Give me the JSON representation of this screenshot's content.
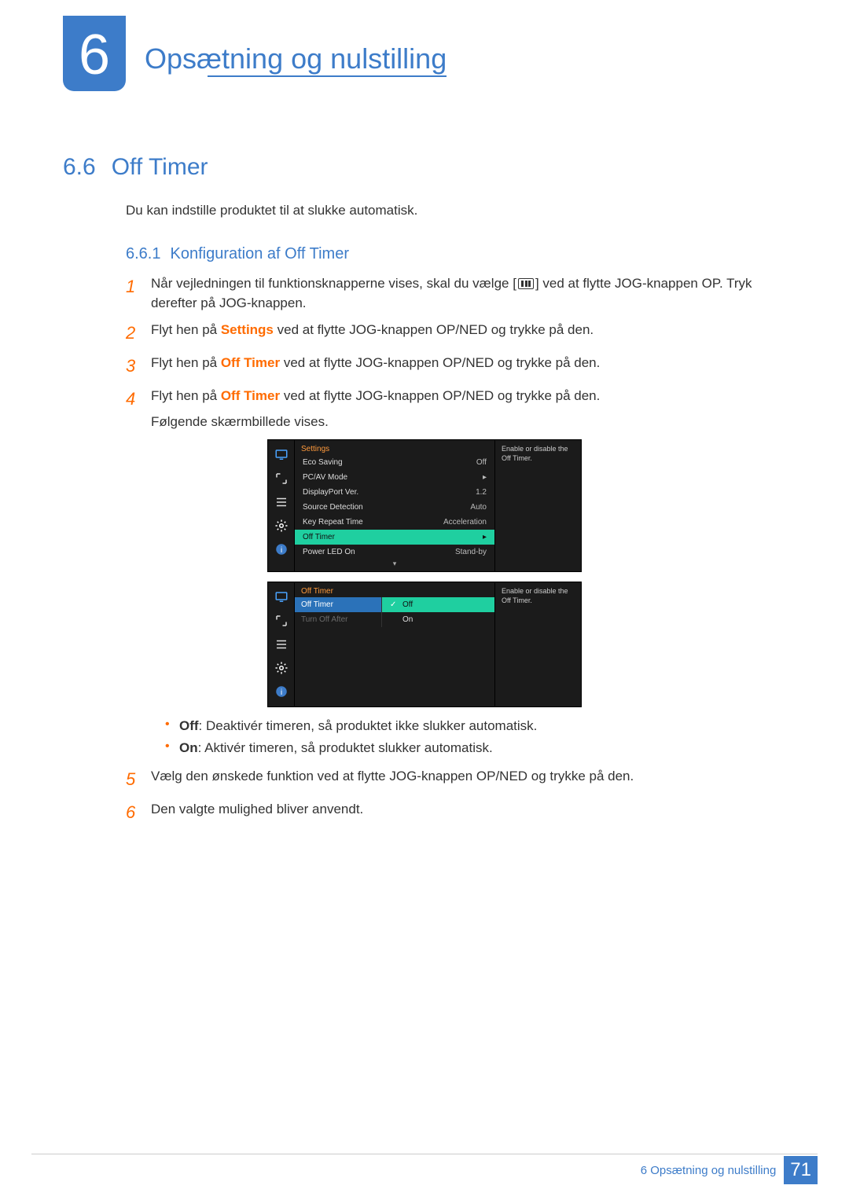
{
  "chapter": {
    "number": "6",
    "title": "Opsætning og nulstilling"
  },
  "section": {
    "number": "6.6",
    "title": "Off Timer",
    "intro": "Du kan indstille produktet til at slukke automatisk."
  },
  "subsection": {
    "number": "6.6.1",
    "title": "Konfiguration af Off Timer"
  },
  "steps": {
    "s1": {
      "n": "1",
      "a": "Når vejledningen til funktionsknapperne vises, skal du vælge [",
      "b": "] ved at flytte JOG-knappen OP. Tryk derefter på JOG-knappen."
    },
    "s2": {
      "n": "2",
      "pre": "Flyt hen på ",
      "bold": "Settings",
      "post": " ved at flytte JOG-knappen OP/NED og trykke på den."
    },
    "s3": {
      "n": "3",
      "pre": "Flyt hen på ",
      "bold": "Off Timer",
      "post": " ved at flytte JOG-knappen OP/NED og trykke på den."
    },
    "s4": {
      "n": "4",
      "pre": "Flyt hen på ",
      "bold": "Off Timer",
      "post": " ved at flytte JOG-knappen OP/NED og trykke på den.",
      "extra": "Følgende skærmbillede vises."
    },
    "s5": {
      "n": "5",
      "t": "Vælg den ønskede funktion ved at flytte JOG-knappen OP/NED og trykke på den."
    },
    "s6": {
      "n": "6",
      "t": "Den valgte mulighed bliver anvendt."
    }
  },
  "osd1": {
    "title": "Settings",
    "rows": [
      {
        "label": "Eco Saving",
        "val": "Off"
      },
      {
        "label": "PC/AV Mode",
        "val": "▸"
      },
      {
        "label": "DisplayPort Ver.",
        "val": "1.2"
      },
      {
        "label": "Source Detection",
        "val": "Auto"
      },
      {
        "label": "Key Repeat Time",
        "val": "Acceleration"
      },
      {
        "label": "Off Timer",
        "val": "▸",
        "hl": true
      },
      {
        "label": "Power LED On",
        "val": "Stand-by"
      }
    ],
    "help": "Enable or disable the Off Timer."
  },
  "osd2": {
    "title": "Off Timer",
    "items": [
      {
        "label": "Off Timer",
        "hl": true
      },
      {
        "label": "Turn Off After",
        "dim": true
      }
    ],
    "options": [
      {
        "label": "Off",
        "hl": true,
        "check": true
      },
      {
        "label": "On"
      }
    ],
    "help": "Enable or disable the Off Timer."
  },
  "bullets": {
    "off_label": "Off",
    "off_text": ": Deaktivér timeren, så produktet ikke slukker automatisk.",
    "on_label": "On",
    "on_text": ": Aktivér timeren, så produktet slukker automatisk."
  },
  "footer": {
    "text": "6 Opsætning og nulstilling",
    "page": "71"
  }
}
